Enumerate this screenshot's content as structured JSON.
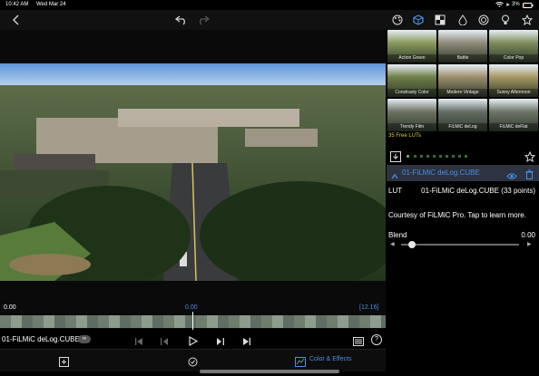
{
  "status_bar": {
    "time": "10:42 AM",
    "date": "Wed Mar 24",
    "battery": "3%"
  },
  "icons": {
    "back": "chevron-left-icon",
    "undo": "undo-icon",
    "redo": "redo-icon",
    "top_tools": [
      "palette-icon",
      "cube-icon",
      "grid-icon",
      "drop-icon",
      "target-icon",
      "light-icon",
      "star-icon"
    ]
  },
  "luts": [
    {
      "label": "Action Green",
      "color": "#8a9a5c"
    },
    {
      "label": "Battle",
      "color": "#8f8a7a"
    },
    {
      "label": "Color Pop",
      "color": "#7d8b5a"
    },
    {
      "label": "Constrasty Color",
      "color": "#6e7d48"
    },
    {
      "label": "Modern Vintage",
      "color": "#9b8c6a"
    },
    {
      "label": "Sunny Afternoon",
      "color": "#a49760"
    },
    {
      "label": "Trendy Film",
      "color": "#6c7262"
    },
    {
      "label": "FiLMiC deLog",
      "color": "#636c64"
    },
    {
      "label": "FiLMiC deFlat",
      "color": "#6d7468"
    }
  ],
  "free_luts_label": "35 Free LUTs",
  "selected_lut": {
    "name": "01-FiLMiC deLog.CUBE"
  },
  "lut_info": {
    "label": "LUT",
    "value": "01-FiLMiC deLog.CUBE (33 points)"
  },
  "courtesy": "Courtesy of FiLMiC Pro. Tap to learn more.",
  "blend": {
    "label": "Blend",
    "value": "0.00",
    "level": 0
  },
  "timeline": {
    "start": "0.00",
    "current": "0.00",
    "end": "[12.16]"
  },
  "clip_name": "01-FiLMiC deLog.CUBE",
  "bottom_bar": {
    "color_effects": "Color & Effects"
  }
}
